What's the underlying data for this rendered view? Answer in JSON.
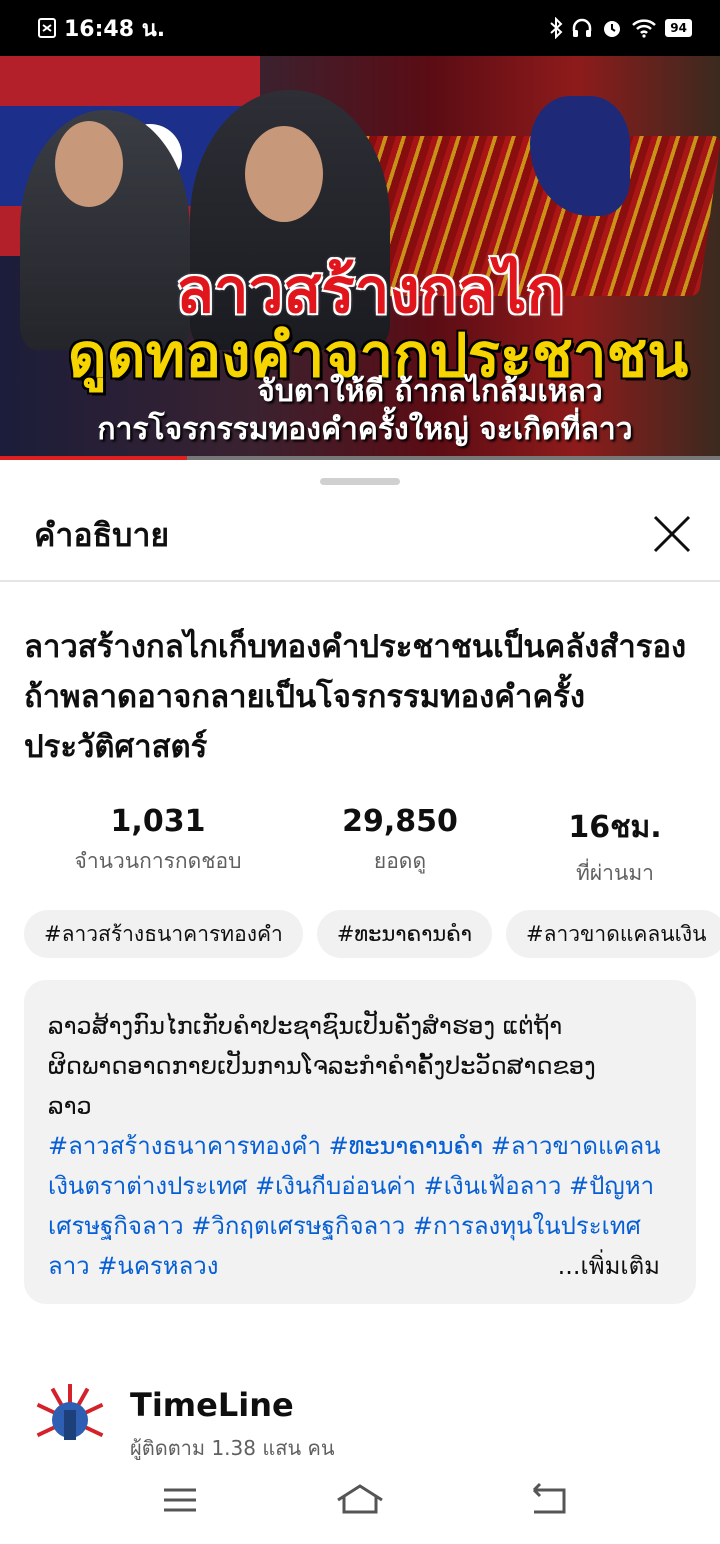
{
  "status_bar": {
    "time": "16:48 น.",
    "battery": "94"
  },
  "video": {
    "overlay_line1": "ลาวสร้างกลไก",
    "overlay_line2": "ดูดทองคำจากประชาชน",
    "overlay_line3": "จับตาให้ดี ถ้ากลไกล้มเหลว",
    "overlay_line4": "การโจรกรรมทองคำครั้งใหญ่ จะเกิดที่ลาว",
    "progress": 0.26
  },
  "sheet": {
    "title": "คำอธิบาย",
    "close_icon": "close-icon"
  },
  "video_title": "ลาวสร้างกลไกเก็บทองคำประชาชนเป็นคลังสำรอง ถ้าพลาดอาจกลายเป็นโจรกรรมทองคำครั้งประวัติศาสตร์",
  "stats": {
    "likes": {
      "value": "1,031",
      "label": "จำนวนการกดชอบ"
    },
    "views": {
      "value": "29,850",
      "label": "ยอดดู"
    },
    "age": {
      "value": "16ชม.",
      "label": "ที่ผ่านมา"
    }
  },
  "chips": [
    "#ลาวสร้างธนาคารทองคำ",
    "#ທະນາຄານຄຳ",
    "#ลาวขาดแคลนเงิน"
  ],
  "description": {
    "text_line1": "ລາວສ້າງກົນໄກເກັບຄຳປະຊາຊົນເປັນຄັງສຳຮອງ ແຕ່ຖ້າ",
    "text_line2": "ຜິດພາດອາດກາຍເປັນການໂຈລະກຳຄຳຄັ້ງປະວັດສາດຂອງ",
    "text_line3": "ລາວ",
    "tags": [
      "#ลาวสร้างธนาคารทองคำ",
      "#ທະນາຄານຄຳ",
      "#ลาวขาดแคลนเงินตราต่างประเทศ",
      "#เงินกีบอ่อนค่า",
      "#เงินเฟ้อลาว",
      "#ปัญหาเศรษฐกิจลาว",
      "#วิกฤตเศรษฐกิจลาว",
      "#การลงทุนในประเทศลาว",
      "#นครหลวง"
    ],
    "more_label": "...เพิ่มเติม"
  },
  "channel": {
    "name": "TimeLine",
    "subscribers": "ผู้ติดตาม 1.38 แสน คน"
  },
  "navbar": {
    "icons": [
      "menu-icon",
      "home-icon",
      "back-icon"
    ]
  },
  "colors": {
    "link": "#065fd4",
    "progress": "#e02020",
    "chip_bg": "#f1f1f1"
  }
}
